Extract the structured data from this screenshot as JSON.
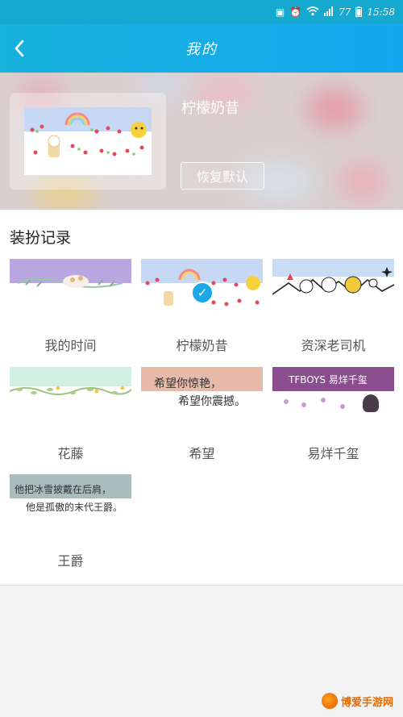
{
  "status_bar": {
    "signal_text": "77",
    "time": "15:58",
    "icons": [
      "notification-icon",
      "alarm-icon",
      "wifi-icon",
      "signal-icon",
      "battery-icon"
    ]
  },
  "nav": {
    "title": "我的",
    "back_icon": "chevron-left-icon"
  },
  "hero": {
    "current_theme": "柠檬奶昔",
    "restore_label": "恢复默认"
  },
  "records": {
    "title": "装扮记录",
    "items": [
      {
        "label": "我的时间",
        "thumb_text": ""
      },
      {
        "label": "柠檬奶昔",
        "thumb_text": "",
        "selected": true
      },
      {
        "label": "资深老司机",
        "thumb_text": ""
      },
      {
        "label": "花藤",
        "thumb_text": ""
      },
      {
        "label": "希望",
        "thumb_text": "希望你惊艳，",
        "thumb_text_2": "希望你震撼。"
      },
      {
        "label": "易烊千玺",
        "thumb_text": "TFBOYS 易烊千玺"
      },
      {
        "label": "王爵",
        "thumb_text": "他把冰雪披戴在后肩，",
        "thumb_text_2": "他是孤傲的末代王爵。"
      }
    ]
  },
  "colors": {
    "primary": "#16b3dc",
    "check": "#1aa9e6"
  },
  "watermark": {
    "text": "博爱手游网"
  }
}
